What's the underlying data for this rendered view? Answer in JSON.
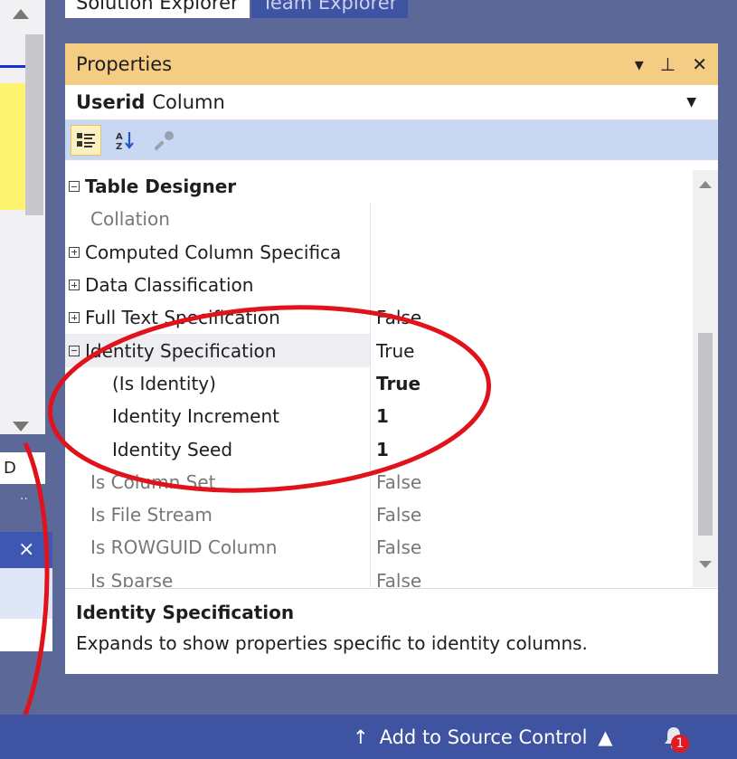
{
  "tabs": [
    {
      "label": "Solution Explorer",
      "active": true
    },
    {
      "label": "Team Explorer",
      "active": false
    }
  ],
  "left_panel": {
    "letter": "D",
    "dots": "..",
    "close": "×"
  },
  "properties": {
    "title": "Properties",
    "object_name": "Userid",
    "object_type": "Column",
    "toolbar_icons": [
      "categorized-icon",
      "alphabetical-icon",
      "property-pages-icon"
    ],
    "rows": [
      {
        "name": "Table Designer",
        "value": "",
        "kind": "category",
        "expander": "minus"
      },
      {
        "name": "Collation",
        "value": "",
        "kind": "grey"
      },
      {
        "name": "Computed Column Specifica",
        "value": "",
        "kind": "normal",
        "expander": "plus"
      },
      {
        "name": "Data Classification",
        "value": "",
        "kind": "normal",
        "expander": "plus"
      },
      {
        "name": "Full Text Specification",
        "value": "False",
        "kind": "normal",
        "expander": "plus"
      },
      {
        "name": "Identity Specification",
        "value": "True",
        "kind": "highlight",
        "expander": "minus"
      },
      {
        "name": "(Is Identity)",
        "value": "True",
        "kind": "nested-bold"
      },
      {
        "name": "Identity Increment",
        "value": "1",
        "kind": "nested-bold"
      },
      {
        "name": "Identity Seed",
        "value": "1",
        "kind": "nested-bold"
      },
      {
        "name": "Is Column Set",
        "value": "False",
        "kind": "grey"
      },
      {
        "name": "Is File Stream",
        "value": "False",
        "kind": "grey"
      },
      {
        "name": "Is ROWGUID Column",
        "value": "False",
        "kind": "grey"
      },
      {
        "name": "Is Sparse",
        "value": "False",
        "kind": "grey"
      }
    ],
    "description": {
      "title": "Identity Specification",
      "text": "Expands to show properties specific to identity columns."
    }
  },
  "status_bar": {
    "source_control": "Add to Source Control",
    "notification_count": "1"
  },
  "colors": {
    "title_bar": "#f5cc84",
    "status_bar": "#3e54a3",
    "annotation": "#e0121b"
  }
}
